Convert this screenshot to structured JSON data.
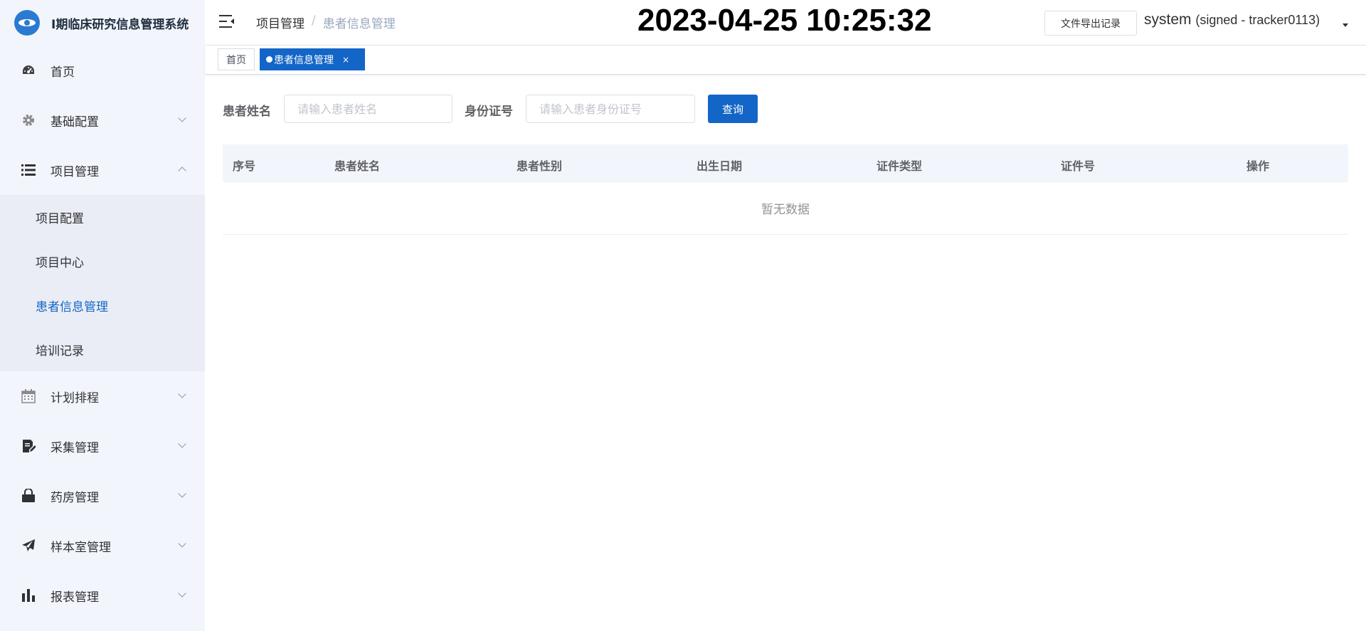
{
  "app": {
    "title": "I期临床研究信息管理系统"
  },
  "sidebar": {
    "items": [
      {
        "label": "首页",
        "icon": "dashboard-icon"
      },
      {
        "label": "基础配置",
        "icon": "gear-icon"
      },
      {
        "label": "项目管理",
        "icon": "list-icon",
        "expanded": true
      },
      {
        "label": "计划排程",
        "icon": "calendar-icon"
      },
      {
        "label": "采集管理",
        "icon": "edit-document-icon"
      },
      {
        "label": "药房管理",
        "icon": "lock-bag-icon"
      },
      {
        "label": "样本室管理",
        "icon": "paper-plane-icon"
      },
      {
        "label": "报表管理",
        "icon": "bar-chart-icon"
      }
    ],
    "project_sub": [
      {
        "label": "项目配置"
      },
      {
        "label": "项目中心"
      },
      {
        "label": "患者信息管理",
        "active": true
      },
      {
        "label": "培训记录"
      }
    ]
  },
  "header": {
    "breadcrumb": {
      "first": "项目管理",
      "separator": "/",
      "current": "患者信息管理"
    },
    "clock": "2023-04-25 10:25:32",
    "export_label": "文件导出记录",
    "user_name": "system",
    "user_signed": "(signed - tracker0113)"
  },
  "tags": {
    "home": "首页",
    "active": "患者信息管理",
    "close": "×"
  },
  "filters": {
    "name_label": "患者姓名",
    "name_placeholder": "请输入患者姓名",
    "id_label": "身份证号",
    "id_placeholder": "请输入患者身份证号",
    "search_label": "查询"
  },
  "table": {
    "columns": [
      "序号",
      "患者姓名",
      "患者性别",
      "出生日期",
      "证件类型",
      "证件号",
      "操作"
    ],
    "empty_text": "暂无数据"
  },
  "colors": {
    "primary": "#1366c7",
    "sidebar_bg": "#f2f5fc",
    "submenu_bg": "#eaedf5"
  }
}
